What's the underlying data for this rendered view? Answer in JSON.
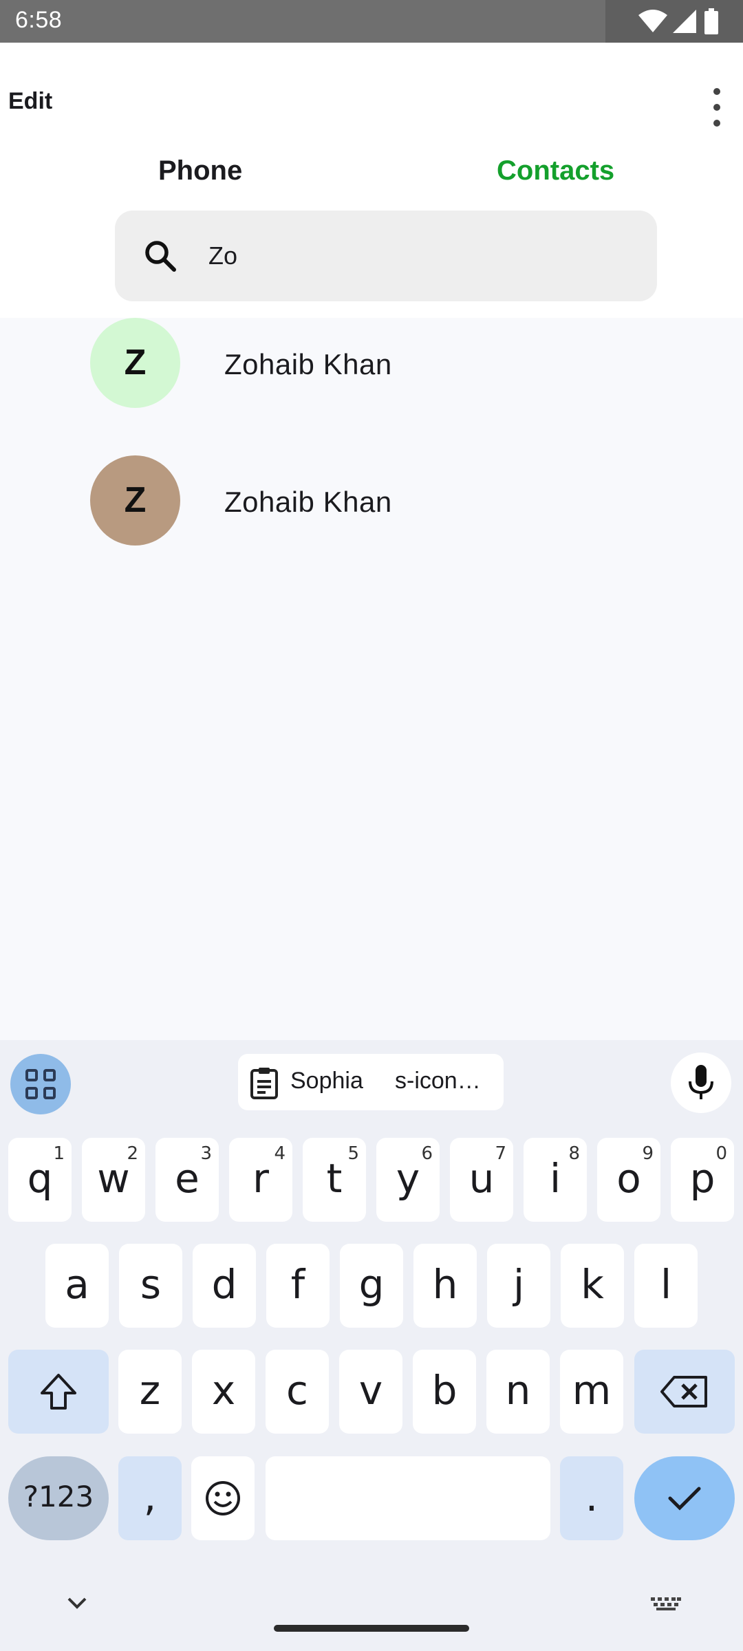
{
  "status_bar": {
    "time": "6:58",
    "icons": [
      "wifi-icon",
      "signal-icon",
      "battery-icon"
    ]
  },
  "appbar": {
    "edit_label": "Edit",
    "more_icon": "more-vert-icon"
  },
  "tabs": [
    {
      "label": "Phone",
      "selected": false
    },
    {
      "label": "Contacts",
      "selected": true,
      "color": "#14a02c"
    }
  ],
  "search": {
    "value": "Zo",
    "icon": "search-icon"
  },
  "contacts": [
    {
      "initial": "Z",
      "name": "Zohaib Khan",
      "avatar_color": "#d3f8d3"
    },
    {
      "initial": "Z",
      "name": "Zohaib Khan",
      "avatar_color": "#b89a80"
    }
  ],
  "keyboard": {
    "clipboard_primary": "Sophia",
    "clipboard_secondary": "s-icon…",
    "row1": [
      {
        "k": "q",
        "n": "1"
      },
      {
        "k": "w",
        "n": "2"
      },
      {
        "k": "e",
        "n": "3"
      },
      {
        "k": "r",
        "n": "4"
      },
      {
        "k": "t",
        "n": "5"
      },
      {
        "k": "y",
        "n": "6"
      },
      {
        "k": "u",
        "n": "7"
      },
      {
        "k": "i",
        "n": "8"
      },
      {
        "k": "o",
        "n": "9"
      },
      {
        "k": "p",
        "n": "0"
      }
    ],
    "row2": [
      "a",
      "s",
      "d",
      "f",
      "g",
      "h",
      "j",
      "k",
      "l"
    ],
    "row3": [
      "z",
      "x",
      "c",
      "v",
      "b",
      "n",
      "m"
    ],
    "symbols_label": "?123",
    "comma_label": ",",
    "period_label": "."
  }
}
